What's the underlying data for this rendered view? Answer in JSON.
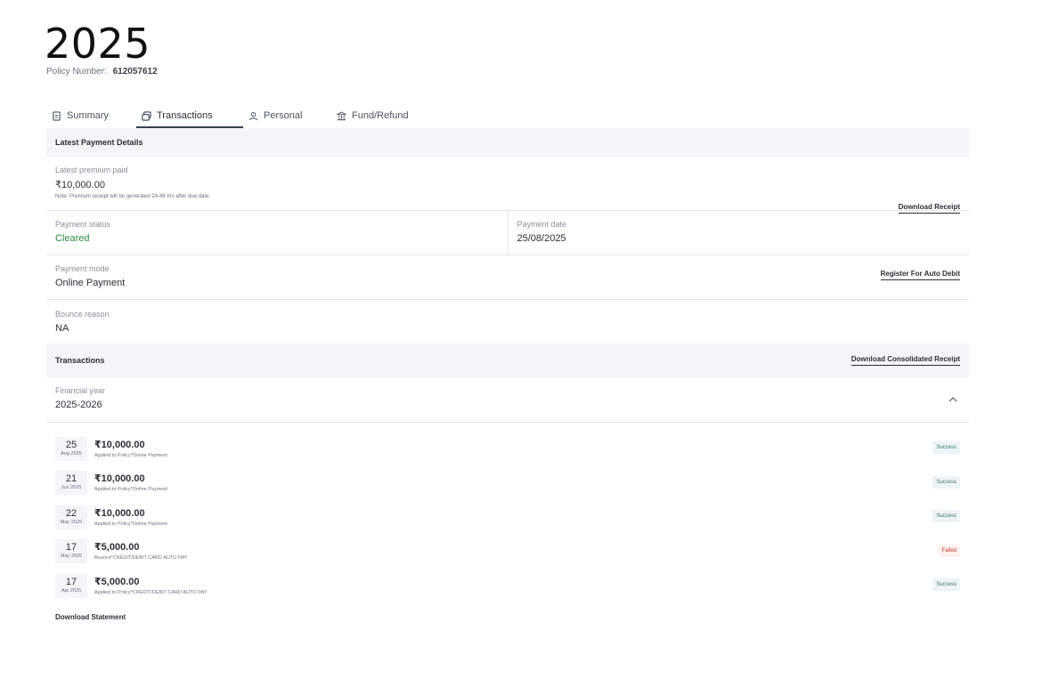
{
  "header": {
    "title": "2025",
    "policy_label": "Policy Number:",
    "policy_number": "612057612"
  },
  "tabs": [
    {
      "label": "Summary",
      "icon": "document-icon"
    },
    {
      "label": "Transactions",
      "icon": "cards-icon",
      "active": true
    },
    {
      "label": "Personal",
      "icon": "person-icon"
    },
    {
      "label": "Fund/Refund",
      "icon": "bank-icon"
    }
  ],
  "latest_payment": {
    "heading": "Latest Payment Details",
    "premium_label": "Latest premium paid",
    "premium_value": "₹10,000.00",
    "premium_note": "Note: Premium receipt will be generated 24-48 hrs after due date.",
    "download_receipt": "Download Receipt",
    "status_label": "Payment status",
    "status_value": "Cleared",
    "date_label": "Payment date",
    "date_value": "25/08/2025",
    "mode_label": "Payment mode",
    "mode_value": "Online Payment",
    "auto_debit": "Register For Auto Debit",
    "bounce_label": "Bounce reason",
    "bounce_value": "NA"
  },
  "transactions": {
    "heading": "Transactions",
    "download_consolidated": "Download Consolidated Receipt",
    "fy_label": "Financial year",
    "fy_value": "2025-2026",
    "items": [
      {
        "day": "25",
        "month": "Aug 2025",
        "amount": "₹10,000.00",
        "desc": "Applied to Policy*Online Payment",
        "status": "Success"
      },
      {
        "day": "21",
        "month": "Jun 2025",
        "amount": "₹10,000.00",
        "desc": "Applied to Policy*Online Payment",
        "status": "Success"
      },
      {
        "day": "22",
        "month": "May 2025",
        "amount": "₹10,000.00",
        "desc": "Applied to Policy*Online Payment",
        "status": "Success"
      },
      {
        "day": "17",
        "month": "May 2025",
        "amount": "₹5,000.00",
        "desc": "Bounce*CREDIT/DEBIT CARD AUTO PAY",
        "status": "Failed"
      },
      {
        "day": "17",
        "month": "Apr 2025",
        "amount": "₹5,000.00",
        "desc": "Applied to Policy*CREDIT/DEBIT CARD AUTO PAY",
        "status": "Success"
      }
    ],
    "download_statement": "Download Statement"
  },
  "colors": {
    "header_bg": "#f3f5f9",
    "cleared_green": "#2e8b3e",
    "failed_red": "#c0392b"
  }
}
